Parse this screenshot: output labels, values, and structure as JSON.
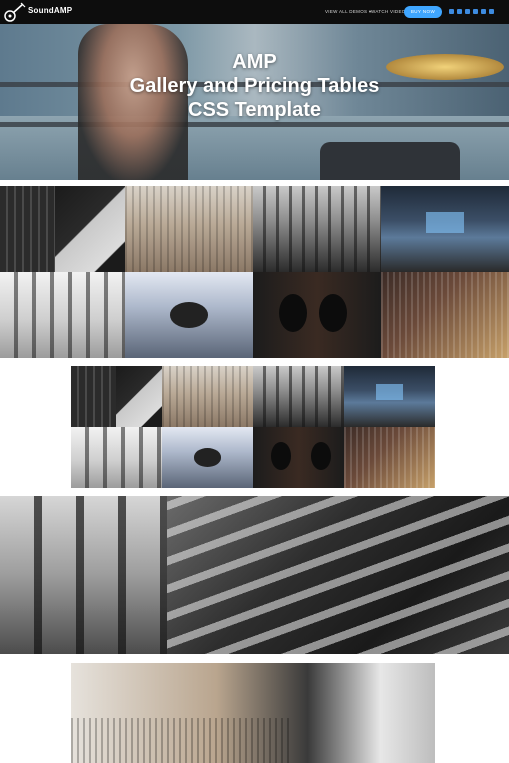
{
  "header": {
    "brand": "SoundAMP",
    "nav": {
      "view_all_demos": "VIEW ALL DEMOS ▾",
      "watch_video": "WATCH VIDEO"
    },
    "buy_label": "BUY NOW",
    "social_icons": [
      "tumblr-icon",
      "facebook-icon",
      "pinterest-icon",
      "linkedin-icon",
      "instagram-icon",
      "vimeo-icon"
    ],
    "accent_color": "#3fa6ff"
  },
  "hero": {
    "line1": "AMP",
    "line2": "Gallery and Pricing Tables",
    "line3": "CSS Template"
  }
}
